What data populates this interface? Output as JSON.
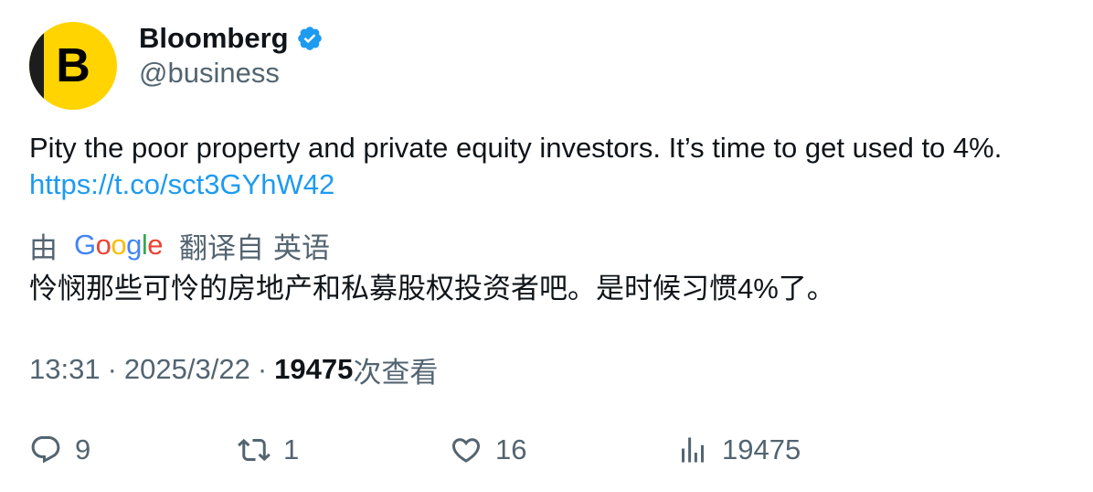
{
  "author": {
    "avatar_letter": "B",
    "name": "Bloomberg",
    "handle": "@business",
    "verified_icon": "verified-badge-icon"
  },
  "tweet": {
    "text": "Pity the poor property and private equity investors. It’s time to get used to 4%.",
    "link": "https://t.co/sct3GYhW42"
  },
  "translation": {
    "prefix": "由",
    "provider_g1": "G",
    "provider_o1": "o",
    "provider_o2": "o",
    "provider_g2": "g",
    "provider_l": "l",
    "provider_e": "e",
    "suffix": "翻译自",
    "language": "英语",
    "text": "怜悯那些可怜的房地产和私募股权投资者吧。是时候习惯4%了。"
  },
  "meta": {
    "time": "13:31",
    "separator": "·",
    "date": "2025/3/22",
    "views_count": "19475",
    "views_label": "次查看"
  },
  "actions": {
    "replies": "9",
    "retweets": "1",
    "likes": "16",
    "views": "19475"
  },
  "colors": {
    "link": "#1d9bf0",
    "muted": "#536471",
    "text": "#0f1419",
    "verified": "#1d9bf0",
    "avatar_bg": "#ffd400"
  }
}
